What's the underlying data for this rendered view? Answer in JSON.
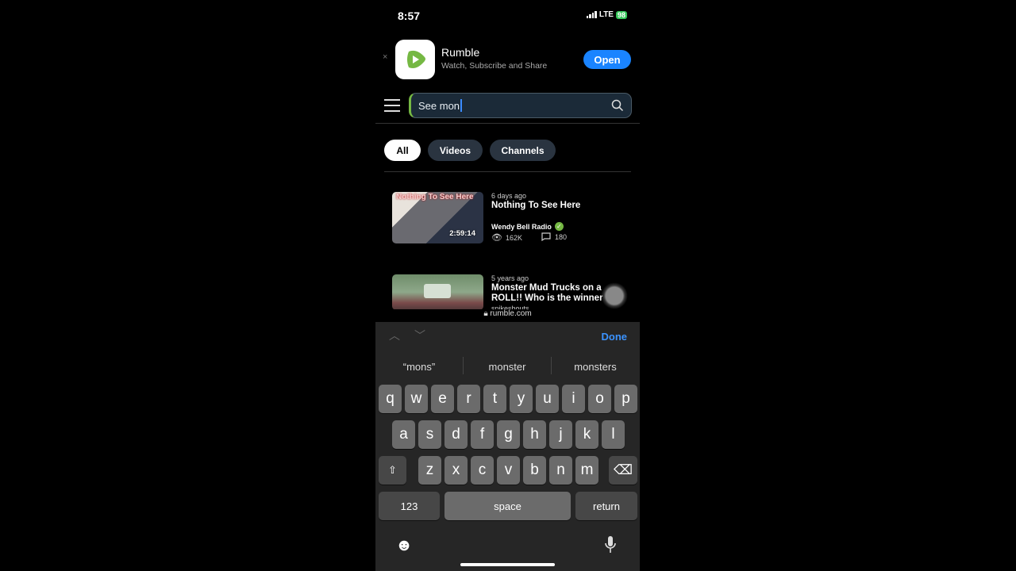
{
  "status_bar": {
    "time": "8:57",
    "network": "LTE",
    "battery": "98"
  },
  "app_banner": {
    "name": "Rumble",
    "subtitle": "Watch, Subscribe and Share",
    "open_label": "Open",
    "close": "×",
    "brand_color": "#75b843"
  },
  "search": {
    "value": "See mon"
  },
  "filters": [
    {
      "label": "All",
      "active": true
    },
    {
      "label": "Videos",
      "active": false
    },
    {
      "label": "Channels",
      "active": false
    }
  ],
  "results": [
    {
      "thumb_text": "Nothing To See Here",
      "duration": "2:59:14",
      "age": "6 days ago",
      "title": "Nothing To See Here",
      "channel": "Wendy Bell Radio",
      "verified": true,
      "views": "162K",
      "comments": "180"
    },
    {
      "age": "5 years ago",
      "title": "Monster Mud Trucks on a ROLL!! Who is the winner for...",
      "channel": "spikeshouts"
    }
  ],
  "url_bar": {
    "domain": "rumble.com"
  },
  "keyboard": {
    "done_label": "Done",
    "suggestions": [
      "“mons”",
      "monster",
      "monsters"
    ],
    "row1": [
      "q",
      "w",
      "e",
      "r",
      "t",
      "y",
      "u",
      "i",
      "o",
      "p"
    ],
    "row2": [
      "a",
      "s",
      "d",
      "f",
      "g",
      "h",
      "j",
      "k",
      "l"
    ],
    "row3": [
      "z",
      "x",
      "c",
      "v",
      "b",
      "n",
      "m"
    ],
    "numbers_label": "123",
    "space_label": "space",
    "return_label": "return"
  }
}
